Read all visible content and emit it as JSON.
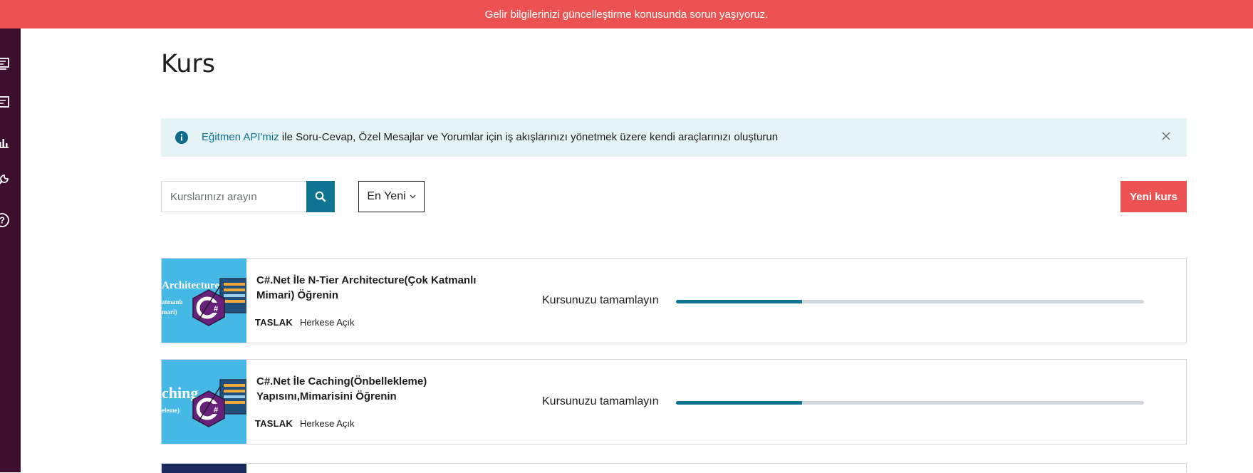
{
  "banner": {
    "text": "Gelir bilgilerinizi güncelleştirme konusunda sorun yaşıyoruz."
  },
  "sidebar": {
    "items": [
      {
        "icon": "tv-icon"
      },
      {
        "icon": "message-icon"
      },
      {
        "icon": "bar-chart-icon"
      },
      {
        "icon": "wrench-icon"
      },
      {
        "icon": "help-icon"
      }
    ]
  },
  "page": {
    "title": "Kurs"
  },
  "info": {
    "link_text": "Eğitmen API'miz",
    "text": " ile Soru-Cevap, Özel Mesajlar ve Yorumlar için iş akışlarınızı yönetmek üzere kendi araçlarınızı oluşturun"
  },
  "search": {
    "placeholder": "Kurslarınızı arayın",
    "value": ""
  },
  "sort": {
    "selected": "En Yeni"
  },
  "new_course": {
    "label": "Yeni kurs"
  },
  "courses": [
    {
      "title": "C#.Net İle N-Tier Architecture(Çok Katmanlı Mimari) Öğrenin",
      "status": "TASLAK",
      "visibility": "Herkese Açık",
      "progress_label": "Kursunuzu tamamlayın",
      "progress": 0.27,
      "thumb_big": "Architecture",
      "thumb_small": [
        "atmanlı",
        "mari)"
      ]
    },
    {
      "title": "C#.Net İle Caching(Önbellekleme) Yapısını,Mimarisini Öğrenin",
      "status": "TASLAK",
      "visibility": "Herkese Açık",
      "progress_label": "Kursunuzu tamamlayın",
      "progress": 0.27,
      "thumb_big": "ching",
      "thumb_small": [
        "eleme)"
      ]
    }
  ],
  "colors": {
    "banner": "#ec5252",
    "sidebar": "#3e0e2f",
    "accent": "#0e7490",
    "info_bg": "#e5f2f6",
    "thumb_bg": "#45b8e5"
  }
}
